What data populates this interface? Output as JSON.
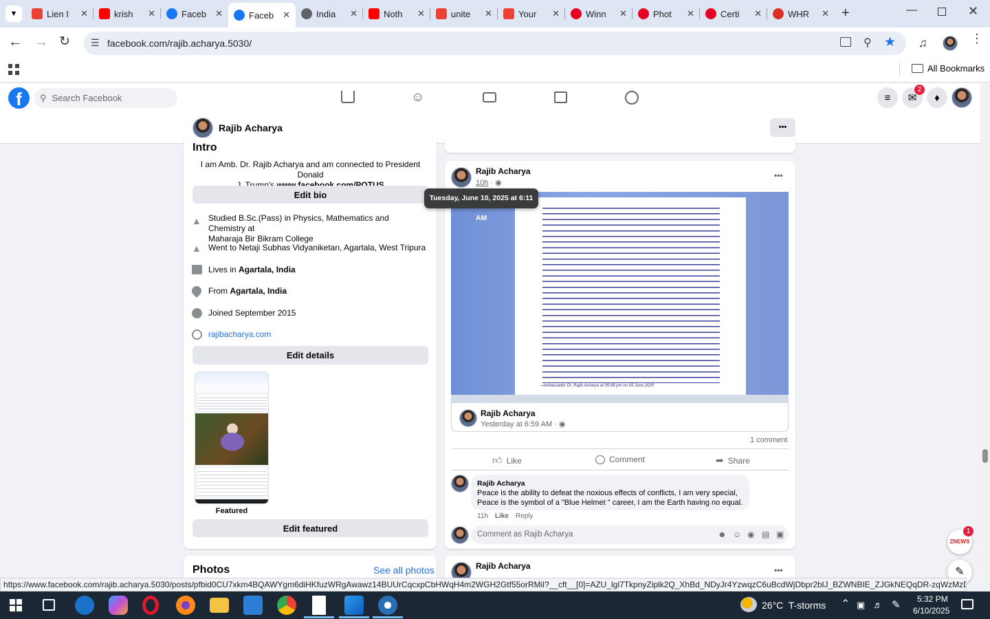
{
  "browser": {
    "tabs": [
      {
        "title": "Lien I",
        "icon": "gmail-icon",
        "color": "#ea4335"
      },
      {
        "title": "krish",
        "icon": "youtube-icon",
        "color": "#ff0000"
      },
      {
        "title": "Faceb",
        "icon": "facebook-icon",
        "color": "#1877f2"
      },
      {
        "title": "Faceb",
        "icon": "facebook-icon",
        "color": "#1877f2",
        "active": true
      },
      {
        "title": "India",
        "icon": "globe-icon",
        "color": "#5f6368"
      },
      {
        "title": "Noth",
        "icon": "youtube-icon",
        "color": "#ff0000"
      },
      {
        "title": "unite",
        "icon": "gmail-icon",
        "color": "#ea4335"
      },
      {
        "title": "Your",
        "icon": "gmail-icon",
        "color": "#ea4335"
      },
      {
        "title": "Winn",
        "icon": "pinterest-icon",
        "color": "#e60023"
      },
      {
        "title": "Phot",
        "icon": "pinterest-icon",
        "color": "#e60023"
      },
      {
        "title": "Certi",
        "icon": "pinterest-icon",
        "color": "#e60023"
      },
      {
        "title": "WHR",
        "icon": "whr-icon",
        "color": "#d93025"
      }
    ],
    "url": "facebook.com/rajib.acharya.5030/",
    "bookmarks_label": "All Bookmarks",
    "status_url": "https://www.facebook.com/rajib.acharya.5030/posts/pfbid0CU7xkm4BQAWYgm6diHKfuzWRgAwawz14BUUrCqcxpCbHWqH4m2WGH2Gtf55orRMil?__cft__[0]=AZU_lgl7TkpnyZiplk2Q_XhBd_NDyJr4YzwqzC6uBcdWjDbpr2blJ_BZWNBIE_ZJGkNEQqDR-zqWzMzDUq1N..."
  },
  "facebook": {
    "search_placeholder": "Search Facebook",
    "messenger_badge": "2",
    "profile_name": "Rajib Acharya",
    "more_label": "•••"
  },
  "intro": {
    "title": "Intro",
    "bio_line1": "I am Amb. Dr. Rajib Acharya and am connected to President Donald",
    "bio_line2_pre": "J. Trump's ",
    "bio_line2_bold": "www.facebook.com/POTUS",
    "edit_bio": "Edit bio",
    "studied_line1": "Studied B.Sc.(Pass) in Physics, Mathematics and Chemistry at",
    "studied_line2": "Maharaja Bir Bikram College",
    "went_to": "Went to Netaji Subhas Vidyaniketan, Agartala, West Tripura",
    "lives_pre": "Lives in ",
    "lives_bold": "Agartala, India",
    "from_pre": "From ",
    "from_bold": "Agartala, India",
    "joined": "Joined September 2015",
    "website": "rajibacharya.com",
    "edit_details": "Edit details",
    "featured_label": "Featured",
    "edit_featured": "Edit featured"
  },
  "photos": {
    "title": "Photos",
    "see_all": "See all photos"
  },
  "post": {
    "author": "Rajib Acharya",
    "time": "10h",
    "tooltip": "Tuesday, June 10, 2025 at 6:11 AM",
    "shared_author": "Rajib Acharya",
    "shared_time": "Yesterday at 6:59 AM",
    "doc_footer": "–Ambassador Dr. Rajib Acharya at 05:08 pm on 05 June 2025",
    "comment_count": "1 comment",
    "like": "Like",
    "comment": "Comment",
    "share": "Share",
    "comment_author": "Rajib Acharya",
    "comment_line1": "Peace is the ability to defeat the noxious effects of conflicts, I am very special,",
    "comment_line2": "Peace is the symbol of a \"Blue Helmet \" career, I am the Earth having no equal.",
    "comment_time": "11h",
    "comment_like": "Like",
    "comment_reply": "Reply",
    "comment_placeholder": "Comment as Rajib Acharya",
    "next_author": "Rajib Acharya"
  },
  "zee_badge": "1",
  "zee_label": "ZNEWS",
  "taskbar": {
    "weather": "26°C  T-storms",
    "time": "5:32 PM",
    "date": "6/10/2025"
  }
}
